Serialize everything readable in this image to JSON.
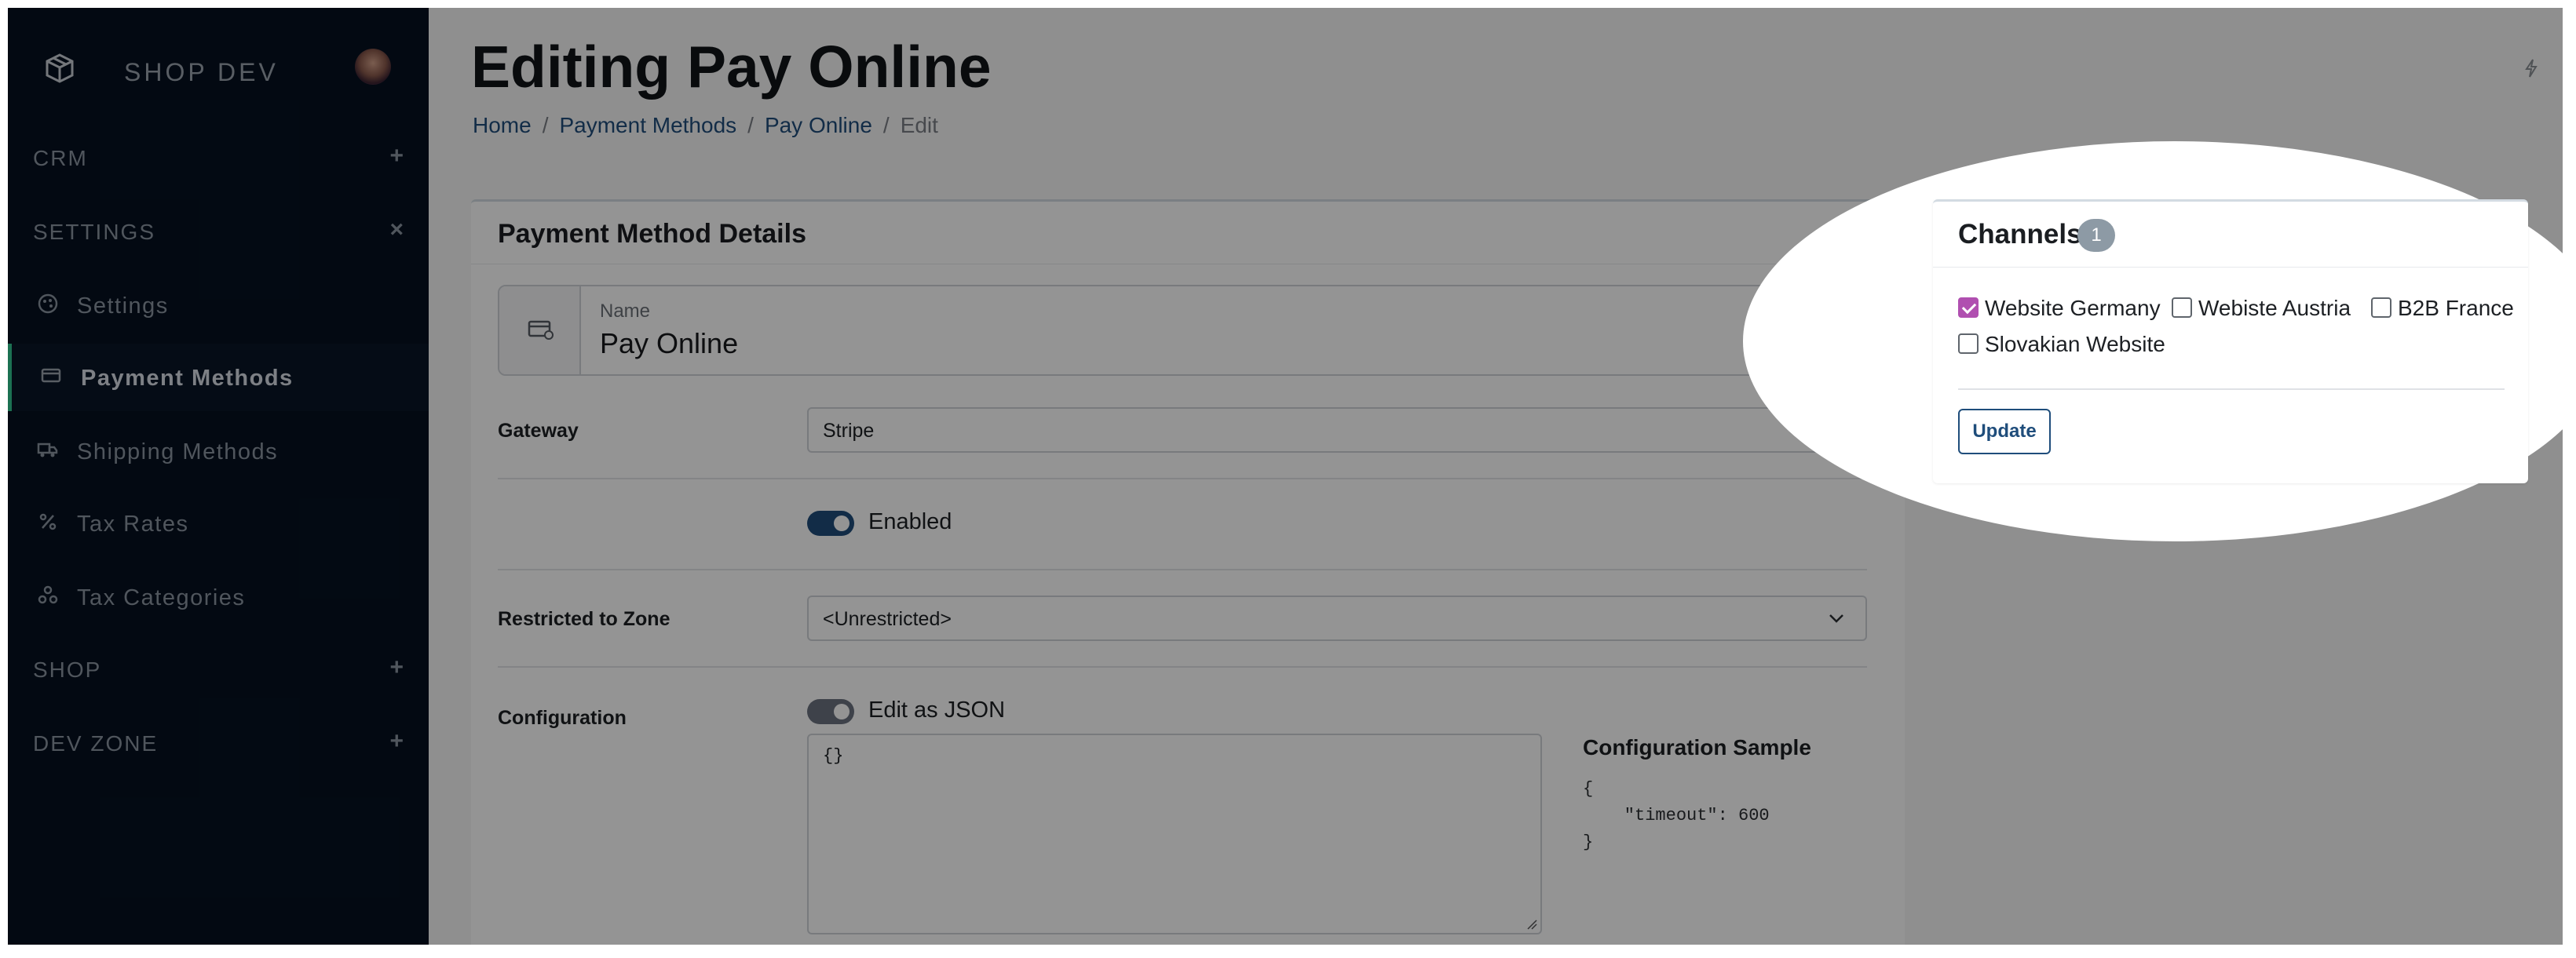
{
  "sidebar": {
    "brand": "SHOP DEV",
    "groups": {
      "crm": {
        "label": "CRM",
        "toggle": "+"
      },
      "settings": {
        "label": "SETTINGS",
        "toggle": "×"
      },
      "shop": {
        "label": "SHOP",
        "toggle": "+"
      },
      "devzone": {
        "label": "DEV ZONE",
        "toggle": "+"
      }
    },
    "items": [
      {
        "label": "Settings",
        "icon": "palette-icon"
      },
      {
        "label": "Payment Methods",
        "icon": "credit-card-icon"
      },
      {
        "label": "Shipping Methods",
        "icon": "truck-icon"
      },
      {
        "label": "Tax Rates",
        "icon": "percent-icon"
      },
      {
        "label": "Tax Categories",
        "icon": "categories-icon"
      }
    ]
  },
  "header": {
    "title": "Editing Pay Online",
    "breadcrumb": [
      "Home",
      "Payment Methods",
      "Pay Online",
      "Edit"
    ],
    "separator": "/"
  },
  "details": {
    "title": "Payment Method Details",
    "name_label": "Name",
    "name_value": "Pay Online",
    "gateway_label": "Gateway",
    "gateway_value": "Stripe",
    "enabled_label": "Enabled",
    "zone_label": "Restricted to Zone",
    "zone_value": "<Unrestricted>",
    "config_label": "Configuration",
    "json_toggle_label": "Edit as JSON",
    "json_value": "{}",
    "sample_title": "Configuration Sample",
    "sample_code": "{\n    \"timeout\": 600\n}"
  },
  "channels": {
    "title": "Channels",
    "badge": "1",
    "options": [
      {
        "label": "Website Germany",
        "checked": true
      },
      {
        "label": "Webiste Austria",
        "checked": false
      },
      {
        "label": "B2B France",
        "checked": false
      },
      {
        "label": "Slovakian Website",
        "checked": false
      }
    ],
    "update_label": "Update"
  },
  "colors": {
    "sidebar_bg": "#061120",
    "accent_green": "#31c38d",
    "link_blue": "#1f4d7b",
    "checkbox_purple": "#b04fb0",
    "toggle_on": "#1f4d7b",
    "toggle_muted": "#6b7280"
  }
}
